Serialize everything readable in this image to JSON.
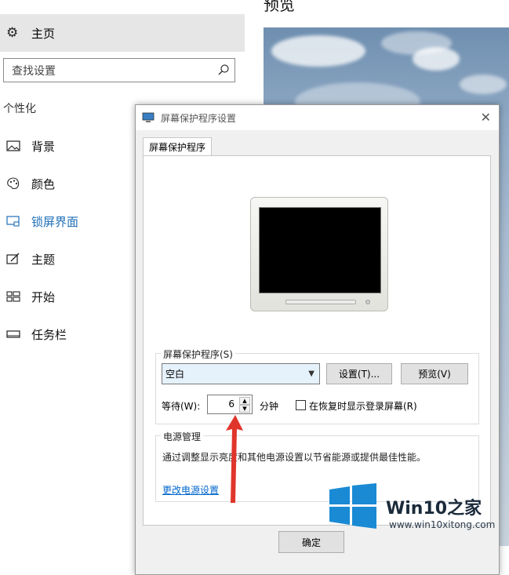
{
  "sidebar": {
    "home_label": "主页",
    "search_placeholder": "查找设置",
    "section_title": "个性化",
    "items": [
      {
        "label": "背景",
        "icon": "picture-icon"
      },
      {
        "label": "颜色",
        "icon": "palette-icon"
      },
      {
        "label": "锁屏界面",
        "icon": "lock-screen-icon",
        "active": true
      },
      {
        "label": "主题",
        "icon": "theme-icon"
      },
      {
        "label": "开始",
        "icon": "start-icon"
      },
      {
        "label": "任务栏",
        "icon": "taskbar-icon"
      }
    ],
    "accent_color": "#1e6fb8"
  },
  "preview": {
    "title": "预览"
  },
  "dialog": {
    "title": "屏幕保护程序设置",
    "close_glyph": "✕",
    "tab_label": "屏幕保护程序",
    "screensaver_group_label": "屏幕保护程序(S)",
    "screensaver_selected": "空白",
    "settings_button": "设置(T)...",
    "preview_button": "预览(V)",
    "wait_label": "等待(W):",
    "wait_value": "6",
    "minutes_label": "分钟",
    "resume_checkbox_label": "在恢复时显示登录屏幕(R)",
    "resume_checked": false,
    "power_group_label": "电源管理",
    "power_description": "通过调整显示亮度和其他电源设置以节省能源或提供最佳性能。",
    "power_link": "更改电源设置",
    "ok_button": "确定"
  },
  "watermark": {
    "brand_prefix": "Win10",
    "brand_suffix": "之家",
    "url": "www.win10xitong.com"
  }
}
